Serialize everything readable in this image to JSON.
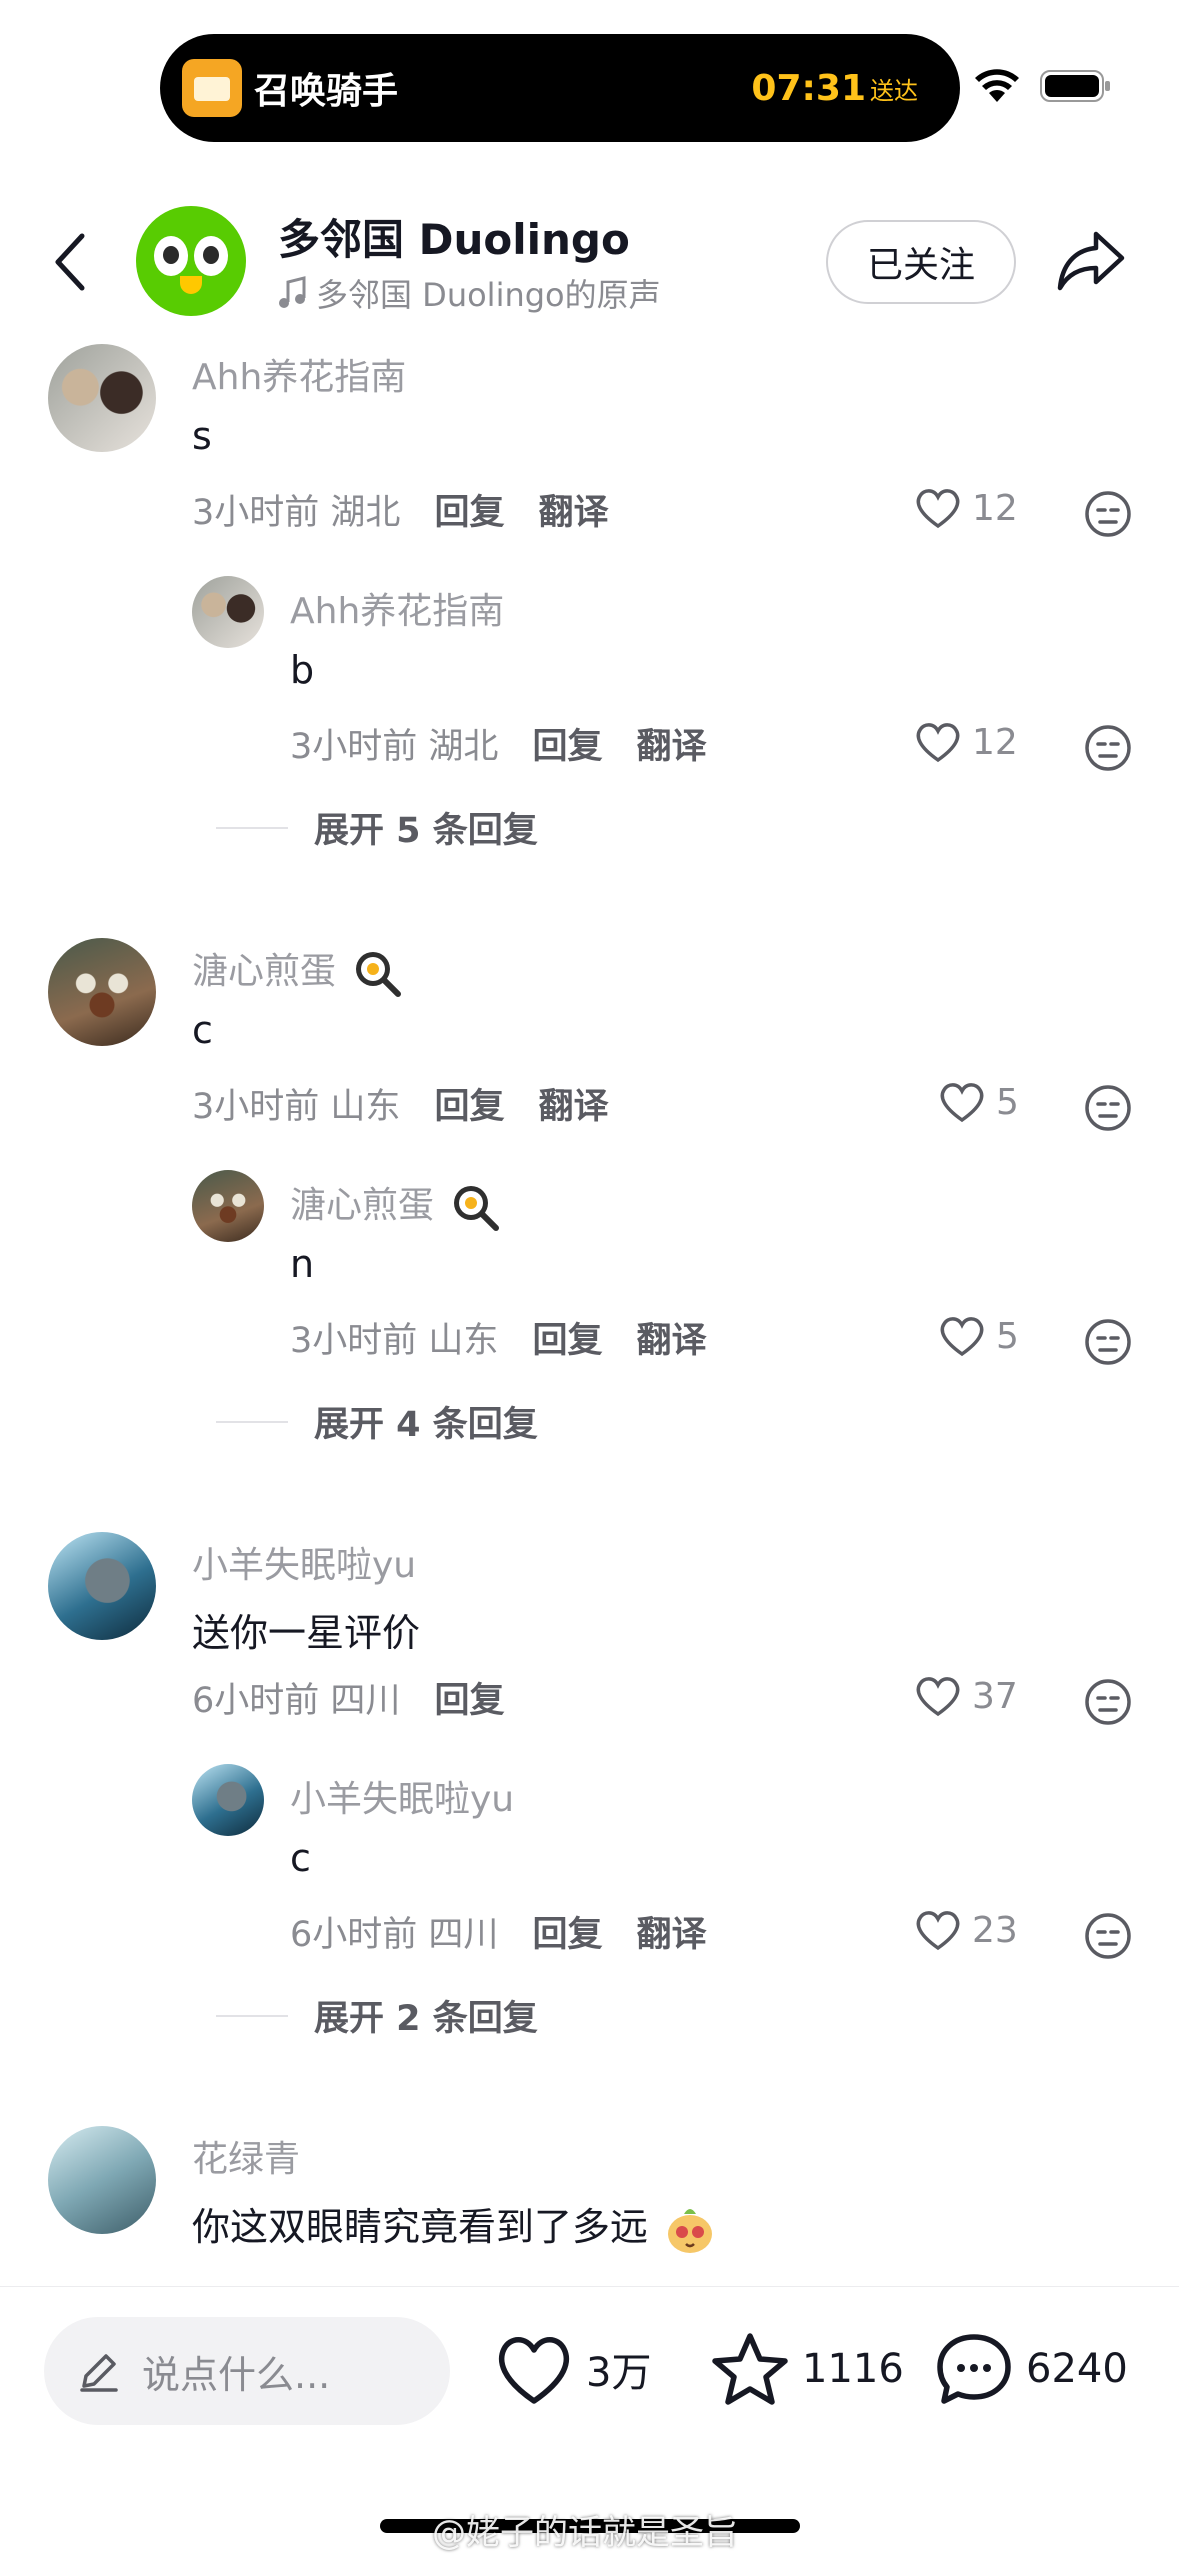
{
  "status_bar": {
    "app_name": "召唤骑手",
    "time": "07:31",
    "status": "送达"
  },
  "header": {
    "title": "多邻国 Duolingo",
    "subtitle": "多邻国 Duolingo的原声",
    "follow_label": "已关注"
  },
  "comments": [
    {
      "user": "Ahh养花指南",
      "text": "s",
      "time": "3小时前",
      "location": "湖北",
      "reply_label": "回复",
      "translate_label": "翻译",
      "likes": "12",
      "reply": {
        "user": "Ahh养花指南",
        "text": "b",
        "time": "3小时前",
        "location": "湖北",
        "reply_label": "回复",
        "translate_label": "翻译",
        "likes": "12"
      },
      "expand_label": "展开 5 条回复"
    },
    {
      "user": "溏心煎蛋",
      "text": "c",
      "time": "3小时前",
      "location": "山东",
      "reply_label": "回复",
      "translate_label": "翻译",
      "likes": "5",
      "reply": {
        "user": "溏心煎蛋",
        "text": "n",
        "time": "3小时前",
        "location": "山东",
        "reply_label": "回复",
        "translate_label": "翻译",
        "likes": "5"
      },
      "expand_label": "展开 4 条回复"
    },
    {
      "user": "小羊失眠啦yu",
      "text": "送你一星评价",
      "time": "6小时前",
      "location": "四川",
      "reply_label": "回复",
      "likes": "37",
      "reply": {
        "user": "小羊失眠啦yu",
        "text": "c",
        "time": "6小时前",
        "location": "四川",
        "reply_label": "回复",
        "translate_label": "翻译",
        "likes": "23"
      },
      "expand_label": "展开 2 条回复"
    },
    {
      "user": "花绿青",
      "text": "你这双眼睛究竟看到了多远"
    }
  ],
  "bottom_bar": {
    "input_placeholder": "说点什么...",
    "likes": "3万",
    "favorites": "1116",
    "comments": "6240"
  },
  "watermark": "@姥子的话就是圣旨"
}
